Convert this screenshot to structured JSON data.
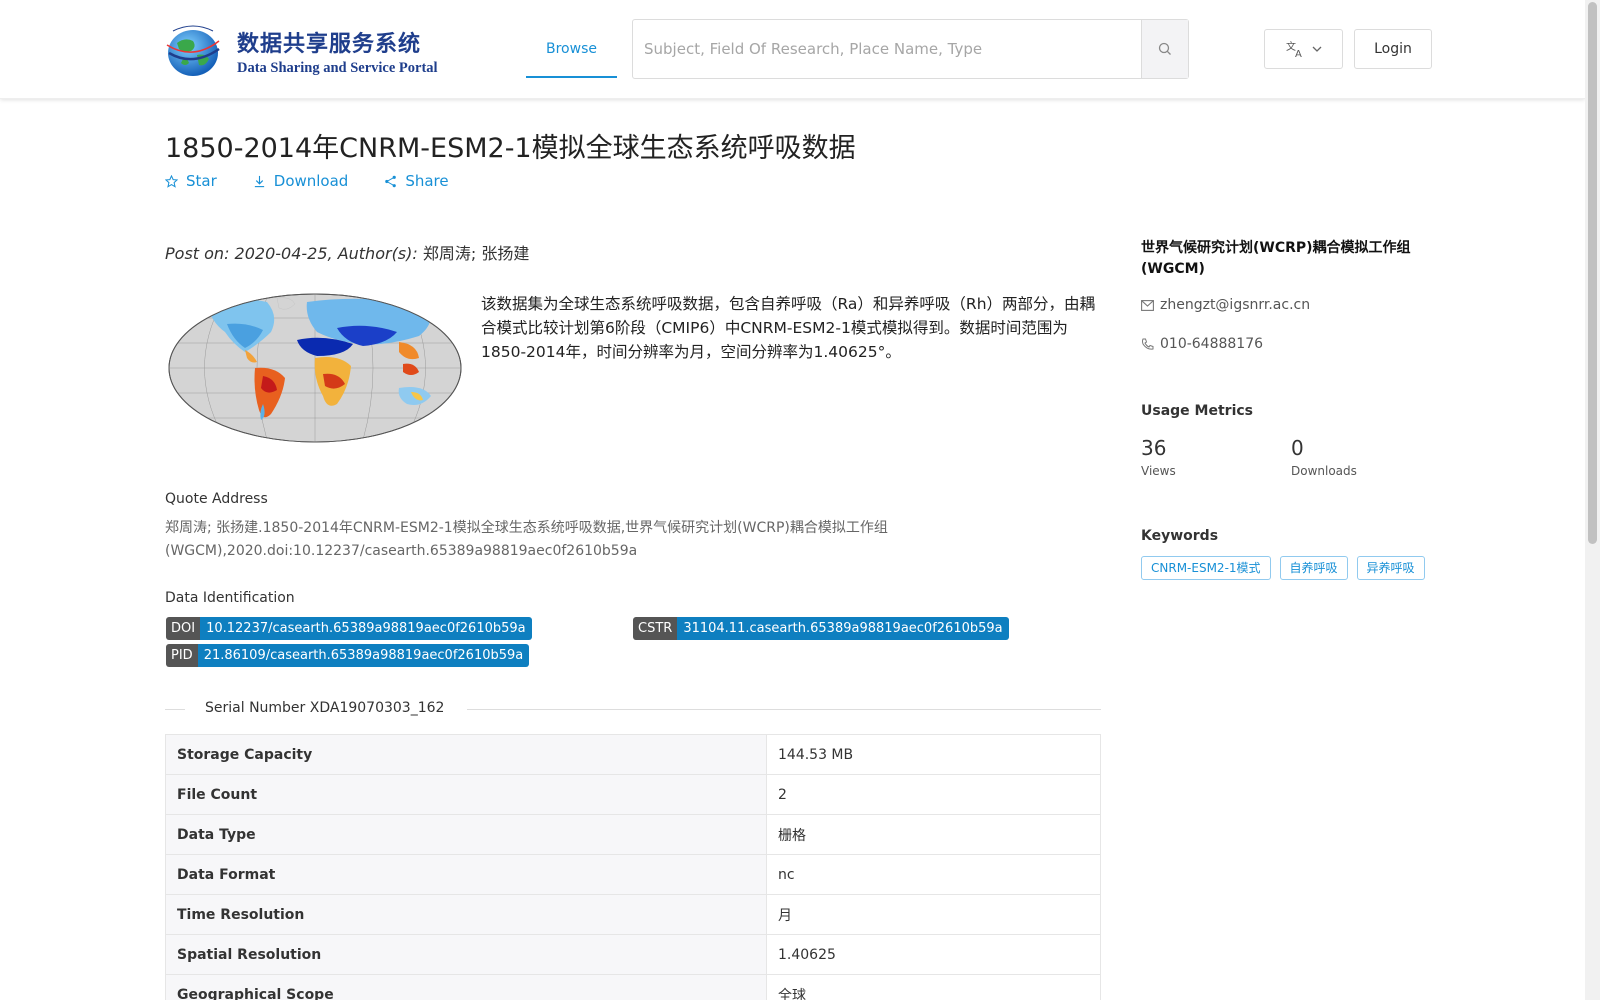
{
  "header": {
    "logo_cn": "数据共享服务系统",
    "logo_en": "Data Sharing and Service Portal",
    "nav_browse": "Browse",
    "search_placeholder": "Subject, Field Of Research, Place Name, Type",
    "search_icon": "search-icon",
    "lang_icon": "translate-icon",
    "login": "Login"
  },
  "dataset": {
    "title": "1850-2014年CNRM-ESM2-1模拟全球生态系统呼吸数据",
    "actions": {
      "star": "Star",
      "download": "Download",
      "share": "Share"
    },
    "post_on_label": "Post on: 2020-04-25, Author(s):",
    "authors": "郑周涛; 张扬建",
    "description": "该数据集为全球生态系统呼吸数据，包含自养呼吸（Ra）和异养呼吸（Rh）两部分，由耦合模式比较计划第6阶段（CMIP6）中CNRM-ESM2-1模式模拟得到。数据时间范围为1850-2014年，时间分辨率为月，空间分辨率为1.40625°。",
    "quote_label": "Quote Address",
    "quote_text": "郑周涛; 张扬建.1850-2014年CNRM-ESM2-1模拟全球生态系统呼吸数据,世界气候研究计划(WCRP)耦合模拟工作组(WGCM),2020.doi:10.12237/casearth.65389a98819aec0f2610b59a",
    "data_id_label": "Data Identification",
    "identifiers": {
      "doi_key": "DOI",
      "doi_val": "10.12237/casearth.65389a98819aec0f2610b59a",
      "cstr_key": "CSTR",
      "cstr_val": "31104.11.casearth.65389a98819aec0f2610b59a",
      "pid_key": "PID",
      "pid_val": "21.86109/casearth.65389a98819aec0f2610b59a"
    },
    "serial": "Serial Number XDA19070303_162",
    "metadata": [
      {
        "key": "Storage Capacity",
        "value": "144.53 MB"
      },
      {
        "key": "File Count",
        "value": "2"
      },
      {
        "key": "Data Type",
        "value": "栅格"
      },
      {
        "key": "Data Format",
        "value": "nc"
      },
      {
        "key": "Time Resolution",
        "value": "月"
      },
      {
        "key": "Spatial Resolution",
        "value": "1.40625"
      },
      {
        "key": "Geographical Scope",
        "value": "全球"
      }
    ]
  },
  "sidebar": {
    "org": "世界气候研究计划(WCRP)耦合模拟工作组(WGCM)",
    "email": "zhengzt@igsnrr.ac.cn",
    "phone": "010-64888176",
    "usage_title": "Usage Metrics",
    "views_count": "36",
    "views_label": "Views",
    "downloads_count": "0",
    "downloads_label": "Downloads",
    "keywords_title": "Keywords",
    "keywords": [
      "CNRM-ESM2-1模式",
      "自养呼吸",
      "异养呼吸"
    ]
  },
  "colors": {
    "accent": "#1890d6",
    "badge_value": "#0e7fc0",
    "badge_key": "#555555"
  }
}
